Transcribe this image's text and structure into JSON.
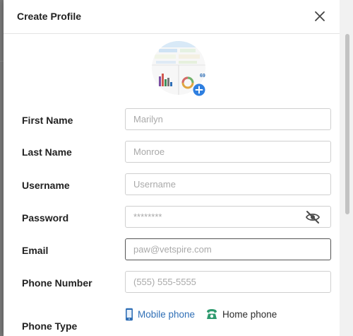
{
  "modal": {
    "title": "Create Profile"
  },
  "form": {
    "first_name": {
      "label": "First Name",
      "value": "",
      "placeholder": "Marilyn"
    },
    "last_name": {
      "label": "Last Name",
      "value": "",
      "placeholder": "Monroe"
    },
    "username": {
      "label": "Username",
      "value": "",
      "placeholder": "Username"
    },
    "password": {
      "label": "Password",
      "value": "",
      "placeholder": "********"
    },
    "email": {
      "label": "Email",
      "value": "",
      "placeholder": "paw@vetspire.com"
    },
    "phone_number": {
      "label": "Phone Number",
      "value": "",
      "placeholder": "(555) 555-5555"
    },
    "phone_type": {
      "label": "Phone Type",
      "options": [
        {
          "label": "Mobile phone",
          "color": "#2f6fb6"
        },
        {
          "label": "Home phone",
          "color": "#2b2b2b"
        }
      ]
    }
  },
  "avatar": {
    "badge_text": "69",
    "add_icon_color": "#2f7fe0"
  },
  "icons": {
    "close": "close-icon",
    "password_toggle": "eye-slash-icon",
    "mobile": "mobile-phone-icon",
    "home": "home-phone-icon",
    "add": "plus-circle-icon"
  },
  "colors": {
    "accent_blue": "#2f6fb6",
    "home_phone_green": "#2e9a6e"
  }
}
